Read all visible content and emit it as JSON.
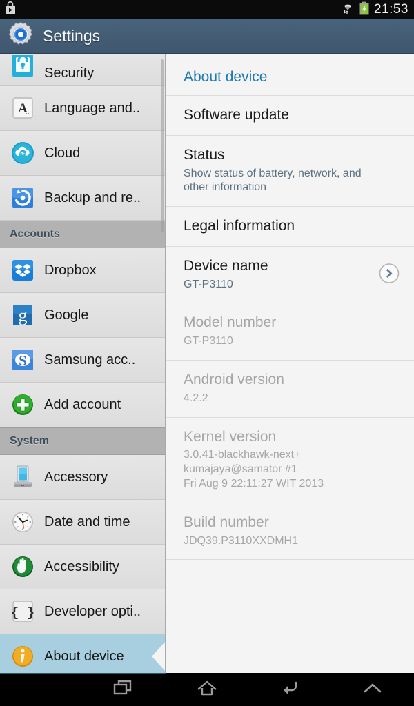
{
  "statusbar": {
    "left_icons": [
      "play-store-icon"
    ],
    "right_icons": [
      "wifi-icon",
      "battery-charging-icon"
    ],
    "clock": "21:53"
  },
  "actionbar": {
    "icon": "settings-gear-icon",
    "title": "Settings"
  },
  "sidebar": {
    "items": [
      {
        "label": "Security",
        "icon": "lock-icon",
        "type": "item",
        "partial": true,
        "selected": false
      },
      {
        "label": "Language and..",
        "icon": "language-a-icon",
        "type": "item",
        "partial": false,
        "selected": false
      },
      {
        "label": "Cloud",
        "icon": "cloud-sync-icon",
        "type": "item",
        "partial": false,
        "selected": false
      },
      {
        "label": "Backup and re..",
        "icon": "backup-restore-icon",
        "type": "item",
        "partial": false,
        "selected": false
      },
      {
        "label": "Accounts",
        "icon": "",
        "type": "header"
      },
      {
        "label": "Dropbox",
        "icon": "dropbox-icon",
        "type": "item",
        "partial": false,
        "selected": false
      },
      {
        "label": "Google",
        "icon": "google-g-icon",
        "type": "item",
        "partial": false,
        "selected": false
      },
      {
        "label": "Samsung acc..",
        "icon": "samsung-s-icon",
        "type": "item",
        "partial": false,
        "selected": false
      },
      {
        "label": "Add account",
        "icon": "add-plus-icon",
        "type": "item",
        "partial": false,
        "selected": false
      },
      {
        "label": "System",
        "icon": "",
        "type": "header"
      },
      {
        "label": "Accessory",
        "icon": "accessory-dock-icon",
        "type": "item",
        "partial": false,
        "selected": false
      },
      {
        "label": "Date and time",
        "icon": "clock-icon",
        "type": "item",
        "partial": false,
        "selected": false
      },
      {
        "label": "Accessibility",
        "icon": "accessibility-hand-icon",
        "type": "item",
        "partial": false,
        "selected": false
      },
      {
        "label": "Developer opti..",
        "icon": "developer-braces-icon",
        "type": "item",
        "partial": false,
        "selected": false
      },
      {
        "label": "About device",
        "icon": "info-icon",
        "type": "item",
        "partial": false,
        "selected": true
      }
    ]
  },
  "detail": {
    "title": "About device",
    "rows": [
      {
        "title": "Software update",
        "subtitle": "",
        "dimmed": false,
        "chevron": false
      },
      {
        "title": "Status",
        "subtitle": "Show status of battery, network, and other information",
        "dimmed": false,
        "chevron": false
      },
      {
        "title": "Legal information",
        "subtitle": "",
        "dimmed": false,
        "chevron": false
      },
      {
        "title": "Device name",
        "subtitle": "GT-P3110",
        "dimmed": false,
        "chevron": true
      },
      {
        "title": "Model number",
        "subtitle": "GT-P3110",
        "dimmed": true,
        "chevron": false
      },
      {
        "title": "Android version",
        "subtitle": "4.2.2",
        "dimmed": true,
        "chevron": false
      },
      {
        "title": "Kernel version",
        "subtitle": "3.0.41-blackhawk-next+\nkumajaya@samator #1\nFri Aug 9 22:11:27 WIT 2013",
        "dimmed": true,
        "chevron": false
      },
      {
        "title": "Build number",
        "subtitle": "JDQ39.P3110XXDMH1",
        "dimmed": true,
        "chevron": false
      }
    ]
  },
  "navbar": {
    "buttons": [
      {
        "name": "recent-apps-icon",
        "label": "Recent apps"
      },
      {
        "name": "home-icon",
        "label": "Home"
      },
      {
        "name": "back-icon",
        "label": "Back"
      },
      {
        "name": "expand-up-icon",
        "label": "Show menu"
      }
    ]
  },
  "colors": {
    "actionbar": "#445e76",
    "accent_blue": "#1f7ab0",
    "selected_row": "#a8cfe0",
    "section_header": "#b2b2b2",
    "sidebar_bg": "#e0e0e0",
    "detail_bg": "#f4f4f4",
    "dim_text": "#a6a6a6",
    "subtitle_text": "#5b7181",
    "statusbar": "#0b0b0b"
  }
}
